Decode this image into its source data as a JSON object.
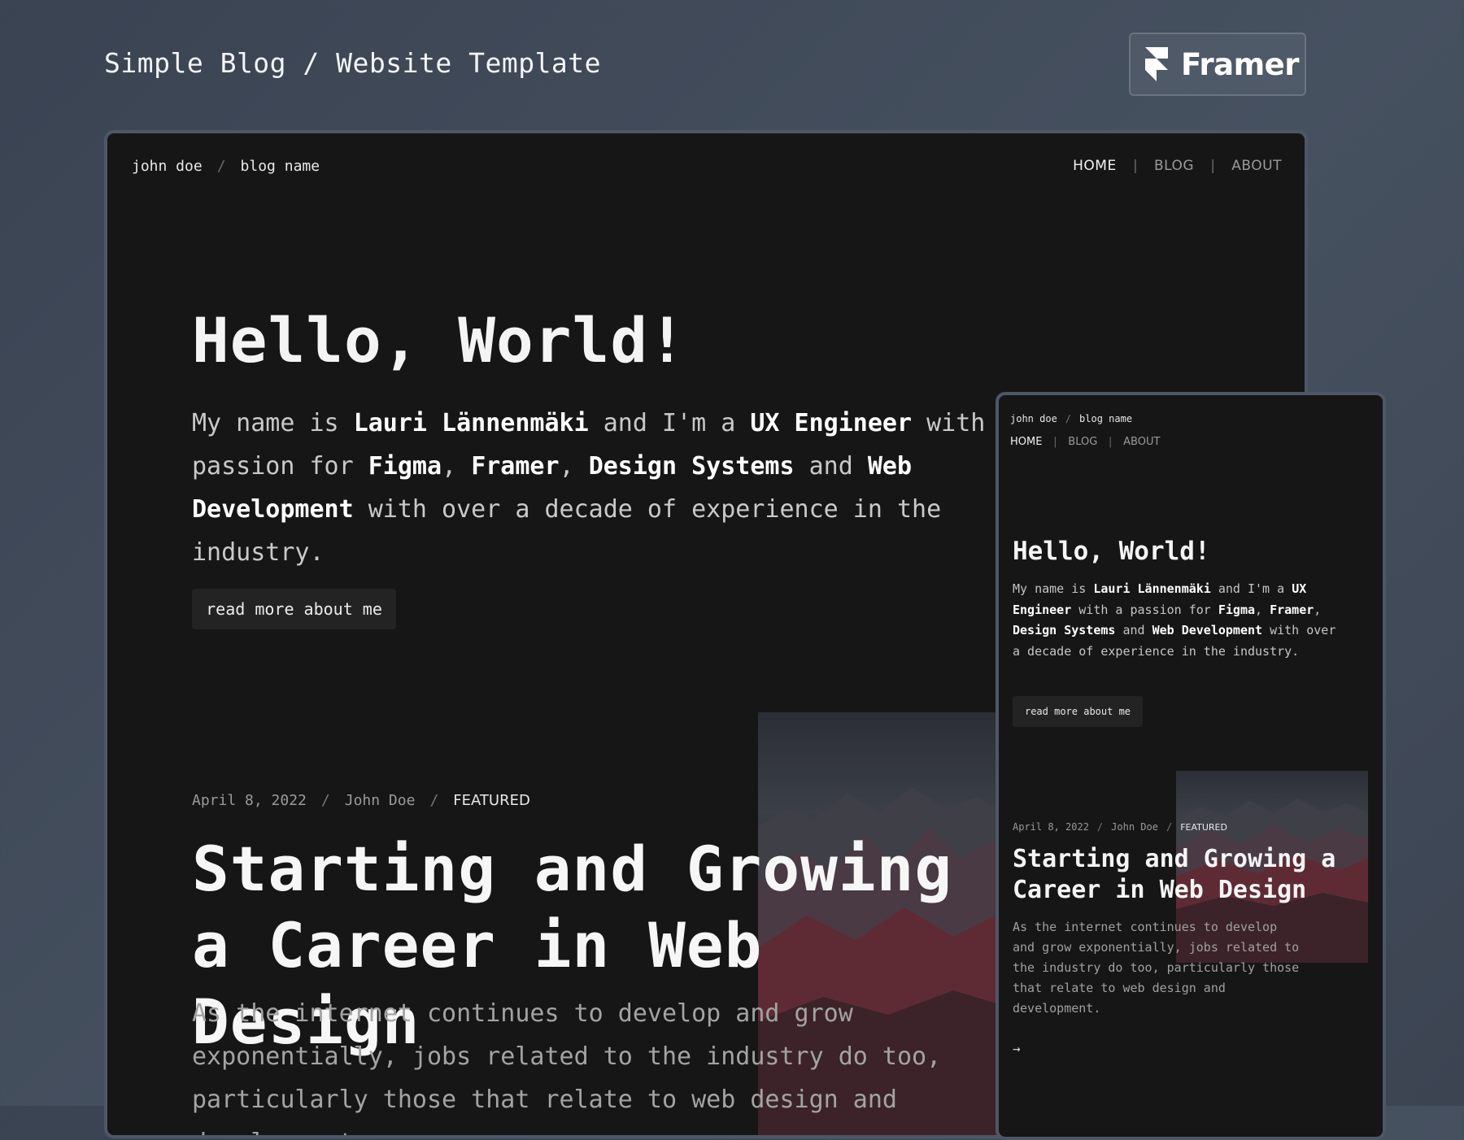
{
  "header": {
    "title": "Simple Blog / Website Template",
    "framer_label": "Framer"
  },
  "site": {
    "author": "john doe",
    "separator": "/",
    "blog_name": "blog name",
    "nav": [
      "HOME",
      "BLOG",
      "ABOUT"
    ],
    "nav_divider": "|",
    "active_nav": "HOME"
  },
  "hero": {
    "title": "Hello, World!",
    "parts": [
      "My name is ",
      "Lauri Lännenmäki",
      " and I'm a ",
      "UX Engineer",
      " with a passion for ",
      "Figma",
      ", ",
      "Framer",
      ", ",
      "Design Systems",
      " and ",
      "Web Development",
      " with over a decade of experience in the industry."
    ],
    "button_label": "read more about me"
  },
  "post": {
    "date": "April 8, 2022",
    "author": "John Doe",
    "tag": "FEATURED",
    "title": "Starting and Growing a Career in Web Design",
    "excerpt": "As the internet continues to develop and grow exponentially, jobs related to the industry do too, particularly those that relate to web design and development.",
    "arrow": "→"
  },
  "icons": {
    "framer": "framer-logo-icon",
    "arrow": "arrow-right-icon",
    "image": "mountain-image"
  },
  "colors": {
    "background": "#3f4857",
    "frame_background": "#161617",
    "frame_border": "#4d5766",
    "text": "#f4f4f4",
    "muted": "#9a9a9a",
    "button": "#232324"
  }
}
